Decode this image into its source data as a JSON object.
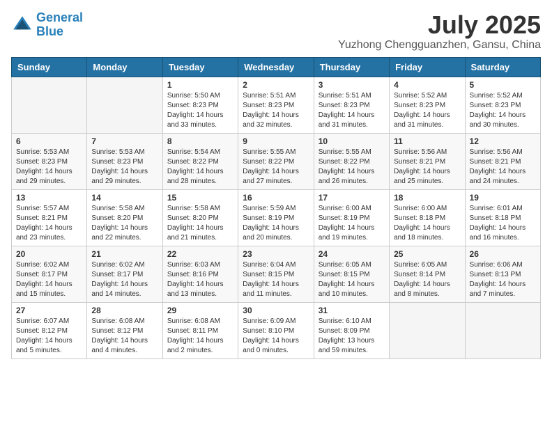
{
  "logo": {
    "line1": "General",
    "line2": "Blue"
  },
  "title": "July 2025",
  "subtitle": "Yuzhong Chengguanzhen, Gansu, China",
  "days_of_week": [
    "Sunday",
    "Monday",
    "Tuesday",
    "Wednesday",
    "Thursday",
    "Friday",
    "Saturday"
  ],
  "weeks": [
    [
      {
        "day": "",
        "info": ""
      },
      {
        "day": "",
        "info": ""
      },
      {
        "day": "1",
        "sunrise": "Sunrise: 5:50 AM",
        "sunset": "Sunset: 8:23 PM",
        "daylight": "Daylight: 14 hours and 33 minutes."
      },
      {
        "day": "2",
        "sunrise": "Sunrise: 5:51 AM",
        "sunset": "Sunset: 8:23 PM",
        "daylight": "Daylight: 14 hours and 32 minutes."
      },
      {
        "day": "3",
        "sunrise": "Sunrise: 5:51 AM",
        "sunset": "Sunset: 8:23 PM",
        "daylight": "Daylight: 14 hours and 31 minutes."
      },
      {
        "day": "4",
        "sunrise": "Sunrise: 5:52 AM",
        "sunset": "Sunset: 8:23 PM",
        "daylight": "Daylight: 14 hours and 31 minutes."
      },
      {
        "day": "5",
        "sunrise": "Sunrise: 5:52 AM",
        "sunset": "Sunset: 8:23 PM",
        "daylight": "Daylight: 14 hours and 30 minutes."
      }
    ],
    [
      {
        "day": "6",
        "sunrise": "Sunrise: 5:53 AM",
        "sunset": "Sunset: 8:23 PM",
        "daylight": "Daylight: 14 hours and 29 minutes."
      },
      {
        "day": "7",
        "sunrise": "Sunrise: 5:53 AM",
        "sunset": "Sunset: 8:23 PM",
        "daylight": "Daylight: 14 hours and 29 minutes."
      },
      {
        "day": "8",
        "sunrise": "Sunrise: 5:54 AM",
        "sunset": "Sunset: 8:22 PM",
        "daylight": "Daylight: 14 hours and 28 minutes."
      },
      {
        "day": "9",
        "sunrise": "Sunrise: 5:55 AM",
        "sunset": "Sunset: 8:22 PM",
        "daylight": "Daylight: 14 hours and 27 minutes."
      },
      {
        "day": "10",
        "sunrise": "Sunrise: 5:55 AM",
        "sunset": "Sunset: 8:22 PM",
        "daylight": "Daylight: 14 hours and 26 minutes."
      },
      {
        "day": "11",
        "sunrise": "Sunrise: 5:56 AM",
        "sunset": "Sunset: 8:21 PM",
        "daylight": "Daylight: 14 hours and 25 minutes."
      },
      {
        "day": "12",
        "sunrise": "Sunrise: 5:56 AM",
        "sunset": "Sunset: 8:21 PM",
        "daylight": "Daylight: 14 hours and 24 minutes."
      }
    ],
    [
      {
        "day": "13",
        "sunrise": "Sunrise: 5:57 AM",
        "sunset": "Sunset: 8:21 PM",
        "daylight": "Daylight: 14 hours and 23 minutes."
      },
      {
        "day": "14",
        "sunrise": "Sunrise: 5:58 AM",
        "sunset": "Sunset: 8:20 PM",
        "daylight": "Daylight: 14 hours and 22 minutes."
      },
      {
        "day": "15",
        "sunrise": "Sunrise: 5:58 AM",
        "sunset": "Sunset: 8:20 PM",
        "daylight": "Daylight: 14 hours and 21 minutes."
      },
      {
        "day": "16",
        "sunrise": "Sunrise: 5:59 AM",
        "sunset": "Sunset: 8:19 PM",
        "daylight": "Daylight: 14 hours and 20 minutes."
      },
      {
        "day": "17",
        "sunrise": "Sunrise: 6:00 AM",
        "sunset": "Sunset: 8:19 PM",
        "daylight": "Daylight: 14 hours and 19 minutes."
      },
      {
        "day": "18",
        "sunrise": "Sunrise: 6:00 AM",
        "sunset": "Sunset: 8:18 PM",
        "daylight": "Daylight: 14 hours and 18 minutes."
      },
      {
        "day": "19",
        "sunrise": "Sunrise: 6:01 AM",
        "sunset": "Sunset: 8:18 PM",
        "daylight": "Daylight: 14 hours and 16 minutes."
      }
    ],
    [
      {
        "day": "20",
        "sunrise": "Sunrise: 6:02 AM",
        "sunset": "Sunset: 8:17 PM",
        "daylight": "Daylight: 14 hours and 15 minutes."
      },
      {
        "day": "21",
        "sunrise": "Sunrise: 6:02 AM",
        "sunset": "Sunset: 8:17 PM",
        "daylight": "Daylight: 14 hours and 14 minutes."
      },
      {
        "day": "22",
        "sunrise": "Sunrise: 6:03 AM",
        "sunset": "Sunset: 8:16 PM",
        "daylight": "Daylight: 14 hours and 13 minutes."
      },
      {
        "day": "23",
        "sunrise": "Sunrise: 6:04 AM",
        "sunset": "Sunset: 8:15 PM",
        "daylight": "Daylight: 14 hours and 11 minutes."
      },
      {
        "day": "24",
        "sunrise": "Sunrise: 6:05 AM",
        "sunset": "Sunset: 8:15 PM",
        "daylight": "Daylight: 14 hours and 10 minutes."
      },
      {
        "day": "25",
        "sunrise": "Sunrise: 6:05 AM",
        "sunset": "Sunset: 8:14 PM",
        "daylight": "Daylight: 14 hours and 8 minutes."
      },
      {
        "day": "26",
        "sunrise": "Sunrise: 6:06 AM",
        "sunset": "Sunset: 8:13 PM",
        "daylight": "Daylight: 14 hours and 7 minutes."
      }
    ],
    [
      {
        "day": "27",
        "sunrise": "Sunrise: 6:07 AM",
        "sunset": "Sunset: 8:12 PM",
        "daylight": "Daylight: 14 hours and 5 minutes."
      },
      {
        "day": "28",
        "sunrise": "Sunrise: 6:08 AM",
        "sunset": "Sunset: 8:12 PM",
        "daylight": "Daylight: 14 hours and 4 minutes."
      },
      {
        "day": "29",
        "sunrise": "Sunrise: 6:08 AM",
        "sunset": "Sunset: 8:11 PM",
        "daylight": "Daylight: 14 hours and 2 minutes."
      },
      {
        "day": "30",
        "sunrise": "Sunrise: 6:09 AM",
        "sunset": "Sunset: 8:10 PM",
        "daylight": "Daylight: 14 hours and 0 minutes."
      },
      {
        "day": "31",
        "sunrise": "Sunrise: 6:10 AM",
        "sunset": "Sunset: 8:09 PM",
        "daylight": "Daylight: 13 hours and 59 minutes."
      },
      {
        "day": "",
        "info": ""
      },
      {
        "day": "",
        "info": ""
      }
    ]
  ]
}
